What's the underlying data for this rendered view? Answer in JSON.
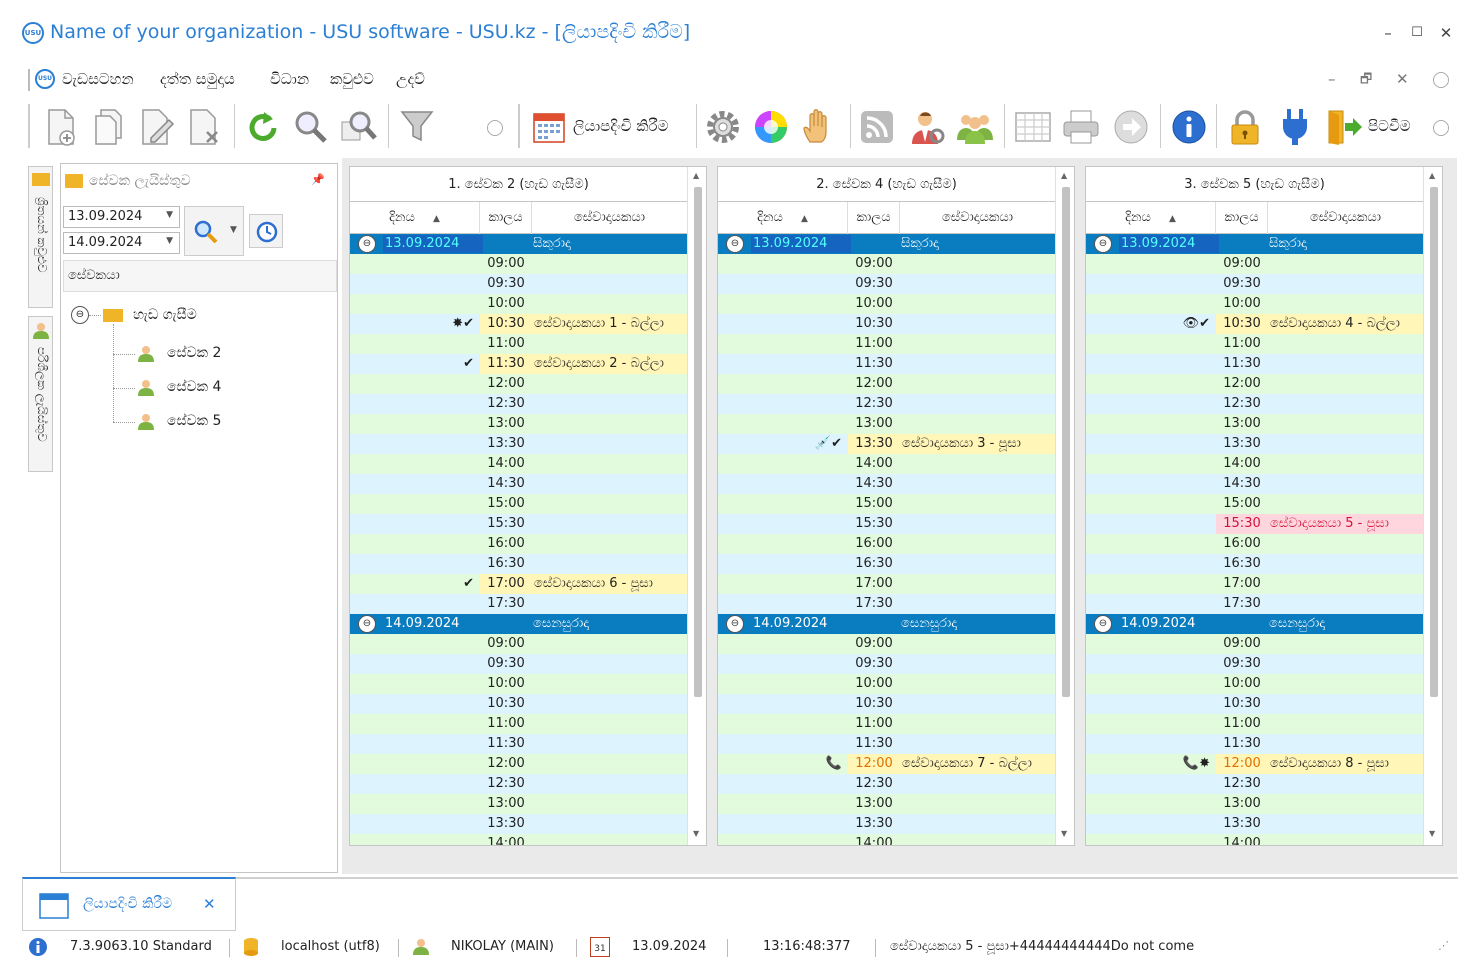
{
  "window": {
    "title": "Name of your organization - USU software - USU.kz - [ලියාපදිංචි කිරීම]",
    "logo": "USU",
    "minimize": "–",
    "maximize": "☐",
    "close": "✕"
  },
  "menu": {
    "items": [
      "වැඩසටහන",
      "දත්ත සමුදාය",
      "විධාන",
      "කවුළුව",
      "උදව්"
    ],
    "controls": {
      "minimize": "–",
      "restore": "🗗",
      "close": "✕"
    }
  },
  "toolbar": {
    "register_label": "ලියාපදිංචි කිරීම",
    "exit_label": "පිටවීම"
  },
  "left_strip": {
    "tab1": "ශ්‍රිතයන් කවුළුව",
    "tab2": "පරිශීලක ලැයිස්තුව"
  },
  "left_panel": {
    "header": "සේවක ලැයිස්තුව",
    "pin": "📌",
    "date_from": "13.09.2024",
    "date_to": "14.09.2024",
    "column_header": "සේවකයා",
    "root": "හැඩ ගැසීම",
    "employees": [
      "සේවක 2",
      "සේවක 4",
      "සේවක 5"
    ]
  },
  "grid_columns": {
    "date": "දිනය",
    "time": "කාලය",
    "client": "සේවාදායකයා"
  },
  "panels": [
    {
      "title": "1. සේවක 2 (හැඩ ගැසීම)",
      "days": [
        {
          "date": "13.09.2024",
          "day": "සිකුරාදා",
          "slots": [
            "09:00",
            "09:30",
            "10:00",
            "10:30",
            "11:00",
            "11:30",
            "12:00",
            "12:30",
            "13:00",
            "13:30",
            "14:00",
            "14:30",
            "15:00",
            "15:30",
            "16:00",
            "16:30",
            "17:00",
            "17:30"
          ]
        },
        {
          "date": "14.09.2024",
          "day": "සෙනසුරාදා",
          "slots": [
            "09:00",
            "09:30",
            "10:00",
            "10:30",
            "11:00",
            "11:30",
            "12:00",
            "12:30",
            "13:00",
            "13:30",
            "14:00"
          ]
        }
      ],
      "appointments": [
        {
          "day": 0,
          "slot": 3,
          "client": "සේවාදායකයා 1 - බල්ලා",
          "icons": "✸✔"
        },
        {
          "day": 0,
          "slot": 5,
          "client": "සේවාදායකයා 2 - බල්ලා",
          "icons": "✔"
        },
        {
          "day": 0,
          "slot": 16,
          "client": "සේවාදායකයා 6 - පූසා",
          "icons": "✔"
        }
      ]
    },
    {
      "title": "2. සේවක 4 (හැඩ ගැසීම)",
      "days": [
        {
          "date": "13.09.2024",
          "day": "සිකුරාදා",
          "slots": [
            "09:00",
            "09:30",
            "10:00",
            "10:30",
            "11:00",
            "11:30",
            "12:00",
            "12:30",
            "13:00",
            "13:30",
            "14:00",
            "14:30",
            "15:00",
            "15:30",
            "16:00",
            "16:30",
            "17:00",
            "17:30"
          ]
        },
        {
          "date": "14.09.2024",
          "day": "සෙනසුරාදා",
          "slots": [
            "09:00",
            "09:30",
            "10:00",
            "10:30",
            "11:00",
            "11:30",
            "12:00",
            "12:30",
            "13:00",
            "13:30",
            "14:00"
          ]
        }
      ],
      "appointments": [
        {
          "day": 0,
          "slot": 9,
          "client": "සේවාදායකයා 3 - පූසා",
          "icons": "💉✔"
        },
        {
          "day": 1,
          "slot": 6,
          "client": "සේවාදායකයා 7 - බල්ලා",
          "icons": "📞",
          "orange": true
        }
      ]
    },
    {
      "title": "3. සේවක 5 (හැඩ ගැසීම)",
      "days": [
        {
          "date": "13.09.2024",
          "day": "සිකුරාදා",
          "slots": [
            "09:00",
            "09:30",
            "10:00",
            "10:30",
            "11:00",
            "11:30",
            "12:00",
            "12:30",
            "13:00",
            "13:30",
            "14:00",
            "14:30",
            "15:00",
            "15:30",
            "16:00",
            "16:30",
            "17:00",
            "17:30"
          ]
        },
        {
          "date": "14.09.2024",
          "day": "සෙනසුරාදා",
          "slots": [
            "09:00",
            "09:30",
            "10:00",
            "10:30",
            "11:00",
            "11:30",
            "12:00",
            "12:30",
            "13:00",
            "13:30",
            "14:00"
          ]
        }
      ],
      "appointments": [
        {
          "day": 0,
          "slot": 3,
          "client": "සේවාදායකයා 4 - බල්ලා",
          "icons": "👁✔"
        },
        {
          "day": 0,
          "slot": 13,
          "client": "සේවාදායකයා 5 - පූසා",
          "icons": "",
          "red": true
        },
        {
          "day": 1,
          "slot": 6,
          "client": "සේවාදායකයා 8 - පූසා",
          "icons": "📞✸",
          "orange": true
        }
      ]
    }
  ],
  "bottom_tab": {
    "label": "ලියාපදිංචි කිරීම",
    "close": "✕"
  },
  "status": {
    "version": "7.3.9063.10 Standard",
    "db": "localhost (utf8)",
    "user": "NIKOLAY (MAIN)",
    "calendar_day": "31",
    "date": "13.09.2024",
    "time": "13:16:48:377",
    "message": "සේවාදායකයා 5 - පූසා+44444444444Do not come"
  },
  "colors": {
    "accent": "#2b7fd4",
    "date_row": "#0a7cc0",
    "row_blue": "#ddf4ff",
    "row_green": "#e1fbdc",
    "highlight": "#fff6b8",
    "highlight_red": "#ffd6dd"
  }
}
